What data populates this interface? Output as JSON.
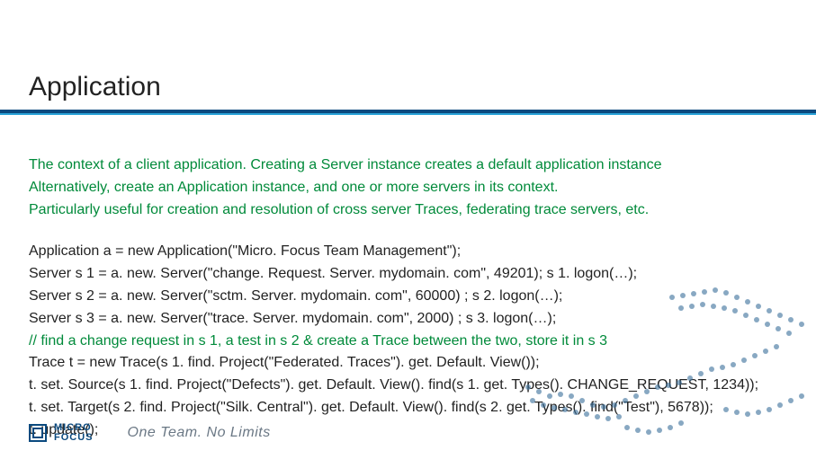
{
  "title": "Application",
  "desc": {
    "line1": "The context of a client application. Creating a Server instance creates a default application instance",
    "line2": " Alternatively, create an Application instance, and one or more servers in its context.",
    "line3": "Particularly useful for creation and resolution of cross server Traces, federating trace servers, etc."
  },
  "code": {
    "l1": "Application a = new Application(\"Micro. Focus Team Management\");",
    "l2": "Server s 1 = a. new. Server(\"change. Request. Server. mydomain. com\", 49201); s 1. logon(…);",
    "l3": "Server s 2 = a. new. Server(\"sctm. Server. mydomain. com\", 60000) ; s 2. logon(…);",
    "l4": "Server s 3 = a. new. Server(\"trace. Server. mydomain. com\", 2000) ; s 3. logon(…);",
    "l5": "// find a change request in s 1, a test in s 2 & create a Trace between the two, store it in s 3",
    "l6": "Trace t = new Trace(s 1. find. Project(\"Federated. Traces\"). get. Default. View());",
    "l7": "t. set. Source(s 1. find. Project(\"Defects\"). get. Default. View(). find(s 1. get. Types(). CHANGE_REQUEST, 1234));",
    "l8": "t. set. Target(s 2. find. Project(\"Silk. Central\"). get. Default. View(). find(s 2. get. Types(). find(\"Test\"), 5678));",
    "l9": "t. update();"
  },
  "logo": {
    "top": "MICRO",
    "bottom": "FOCUS"
  },
  "tagline": "One Team. No Limits"
}
